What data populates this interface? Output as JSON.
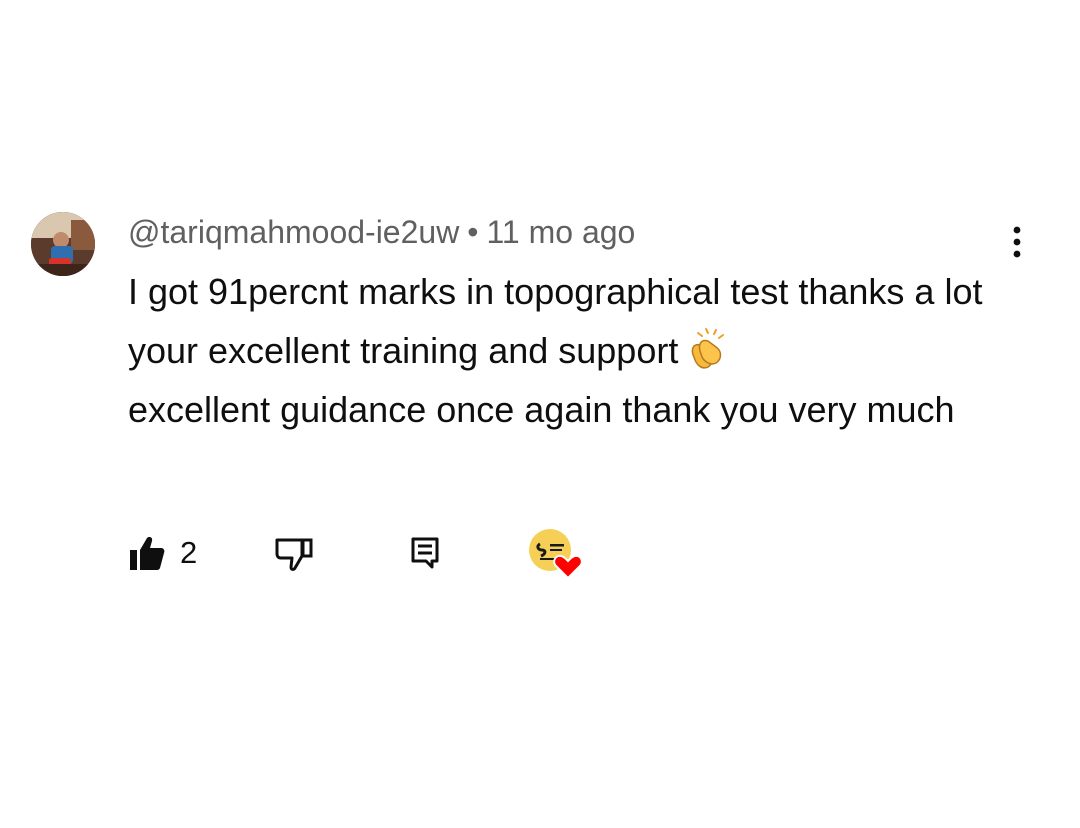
{
  "comment": {
    "username": "@tariqmahmood-ie2uw",
    "separator": "•",
    "time": "11 mo ago",
    "text": "I got 91percnt marks in topographical test thanks a lot your excellent training and support",
    "text_after": "excellent guidance once again thank you very much",
    "emoji": "clapping-hands-icon"
  },
  "actions": {
    "like_icon": "thumbs-up-icon",
    "like_count": "2",
    "dislike_icon": "thumbs-down-icon",
    "reply_icon": "comment-icon",
    "heart_icon": "creator-heart-icon",
    "more_icon": "more-vertical-icon"
  },
  "colors": {
    "text": "#0f0f0f",
    "meta": "#606060",
    "heart": "#ff0000",
    "creator_avatar": "#f6d056"
  }
}
